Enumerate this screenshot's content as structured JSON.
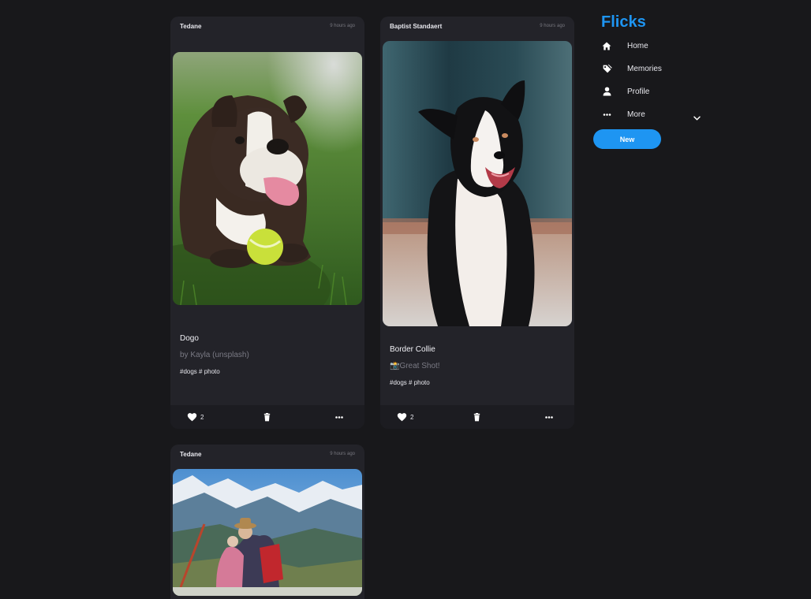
{
  "app": {
    "name": "Flicks"
  },
  "nav": {
    "items": [
      {
        "label": "Home",
        "icon": "home-icon"
      },
      {
        "label": "Memories",
        "icon": "tag-icon"
      },
      {
        "label": "Profile",
        "icon": "person-icon"
      },
      {
        "label": "More",
        "icon": "ellipsis-icon"
      }
    ],
    "new_label": "New"
  },
  "posts": [
    {
      "author": "Tedane",
      "time": "9 hours ago",
      "title": "Dogo",
      "subtitle": "by Kayla (unsplash)",
      "tags": "#dogs # photo",
      "likes": "2",
      "image": "bulldog-on-grass-with-tennis-ball"
    },
    {
      "author": "Baptist Standaert",
      "time": "9 hours ago",
      "title": "Border Collie",
      "subtitle": "📸Great Shot!",
      "tags": "#dogs # photo",
      "likes": "2",
      "image": "border-collie-portrait"
    },
    {
      "author": "Tedane",
      "time": "9 hours ago",
      "image": "couple-mountain-view"
    }
  ],
  "colors": {
    "accent": "#1e95f2",
    "background": "#18181b",
    "card": "#232329",
    "card_footer": "#1c1c21"
  }
}
